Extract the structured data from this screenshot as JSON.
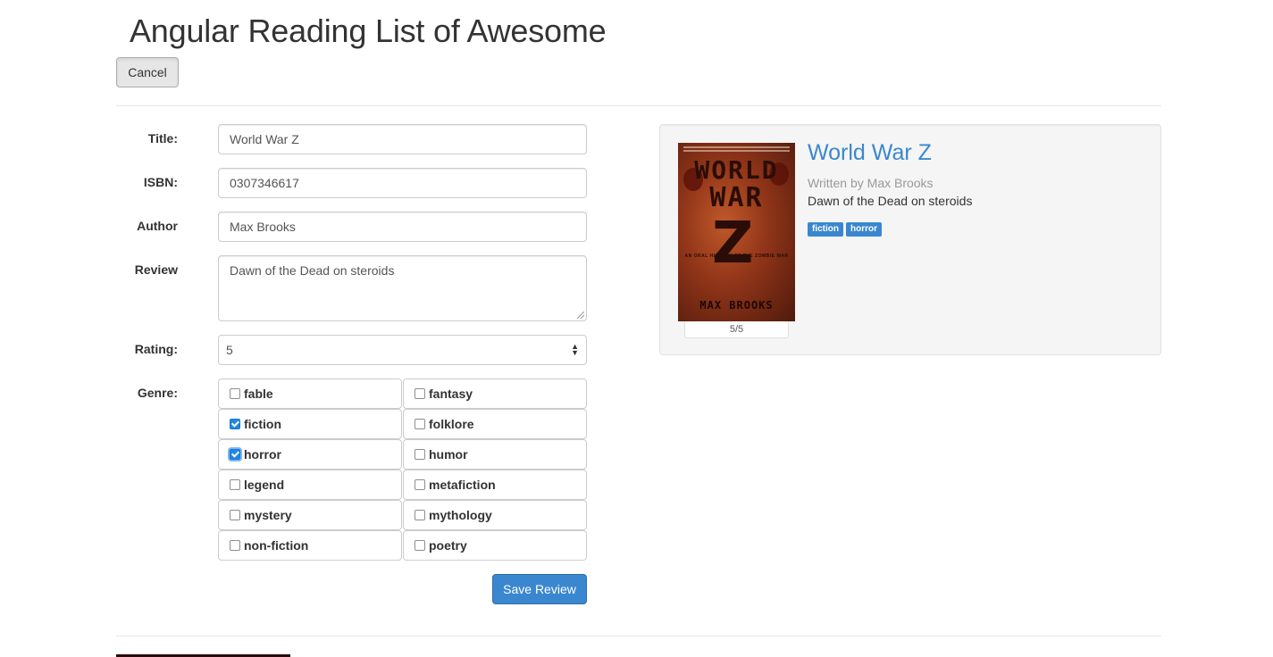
{
  "header": {
    "title": "Angular Reading List of Awesome",
    "cancel_label": "Cancel"
  },
  "form": {
    "title_label": "Title:",
    "title_value": "World War Z",
    "isbn_label": "ISBN:",
    "isbn_value": "0307346617",
    "author_label": "Author",
    "author_value": "Max Brooks",
    "review_label": "Review",
    "review_value": "Dawn of the Dead on steroids",
    "rating_label": "Rating:",
    "rating_value": "5",
    "genre_label": "Genre:",
    "genres": [
      {
        "label": "fable",
        "checked": false
      },
      {
        "label": "fantasy",
        "checked": false
      },
      {
        "label": "fiction",
        "checked": true
      },
      {
        "label": "folklore",
        "checked": false
      },
      {
        "label": "horror",
        "checked": true
      },
      {
        "label": "humor",
        "checked": false
      },
      {
        "label": "legend",
        "checked": false
      },
      {
        "label": "metafiction",
        "checked": false
      },
      {
        "label": "mystery",
        "checked": false
      },
      {
        "label": "mythology",
        "checked": false
      },
      {
        "label": "non-fiction",
        "checked": false
      },
      {
        "label": "poetry",
        "checked": false
      }
    ],
    "save_label": "Save Review"
  },
  "preview": {
    "cover": {
      "word1": "WORLD",
      "word2": "WAR",
      "letter": "Z",
      "subtitle": "AN ORAL HISTORY OF THE ZOMBIE WAR",
      "author": "MAX BROOKS"
    },
    "rating_caption": "5/5",
    "title": "World War Z",
    "author_line": "Written by Max Brooks",
    "review": "Dawn of the Dead on steroids",
    "tags": [
      "fiction",
      "horror"
    ]
  },
  "colors": {
    "accent": "#3a87d0",
    "panel_bg": "#f5f5f5",
    "checkbox_checked": "#1e88e5"
  }
}
